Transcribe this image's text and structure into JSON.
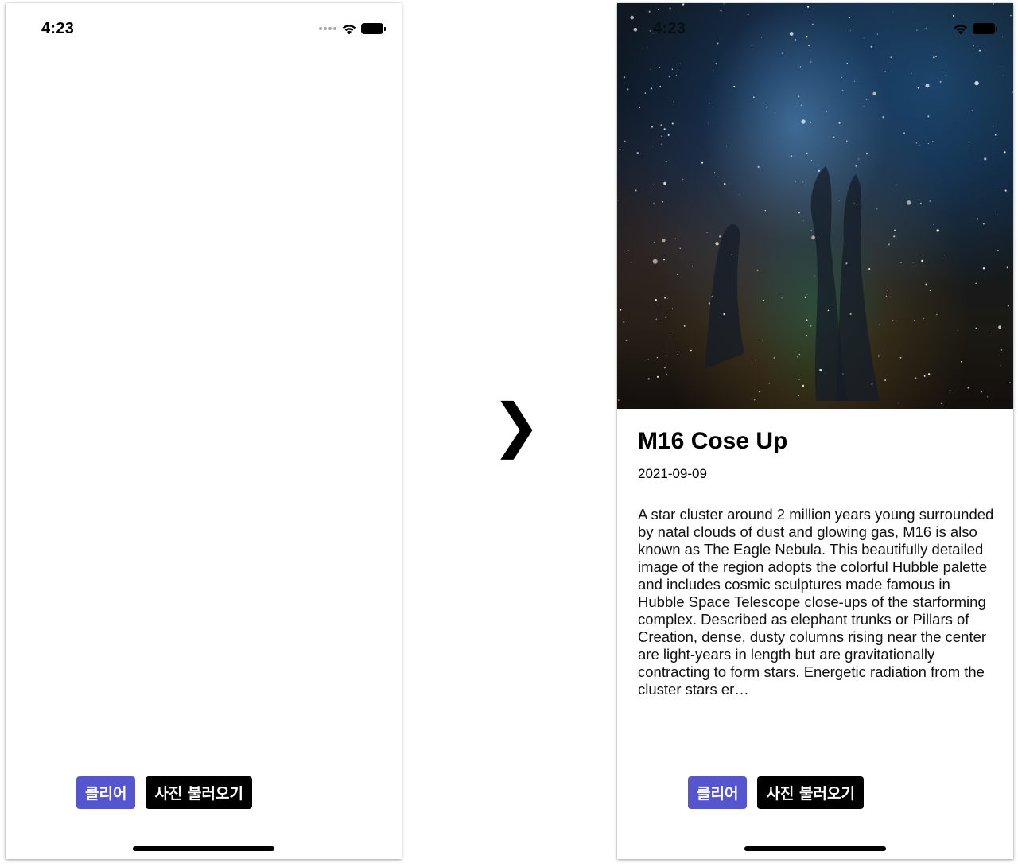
{
  "left_screen": {
    "status_bar": {
      "time": "4:23",
      "icons": [
        "signal-dots-icon",
        "wifi-icon",
        "battery-icon"
      ]
    },
    "buttons": {
      "clear_label": "클리어",
      "load_label": "사진 불러오기"
    }
  },
  "transition": {
    "arrow_glyph": "❯"
  },
  "right_screen": {
    "status_bar": {
      "time": "4:23",
      "icons": [
        "wifi-icon",
        "battery-icon"
      ]
    },
    "photo": {
      "title": "M16 Cose Up",
      "date": "2021-09-09",
      "description": "A star cluster around 2 million years young surrounded by natal clouds of dust and glowing gas, M16 is also known as The Eagle Nebula. This beautifully detailed image of the region adopts the colorful Hubble palette and includes cosmic sculptures made famous in Hubble Space Telescope close-ups of the starforming complex. Described as elephant trunks or Pillars of Creation, dense, dusty columns rising near the center are light-years in length but are gravitationally contracting to form stars. Energetic radiation from the cluster stars er…"
    },
    "buttons": {
      "clear_label": "클리어",
      "load_label": "사진 불러오기"
    }
  },
  "colors": {
    "clear_button": "#5555d0",
    "load_button": "#000000",
    "home_indicator": "#000000"
  }
}
